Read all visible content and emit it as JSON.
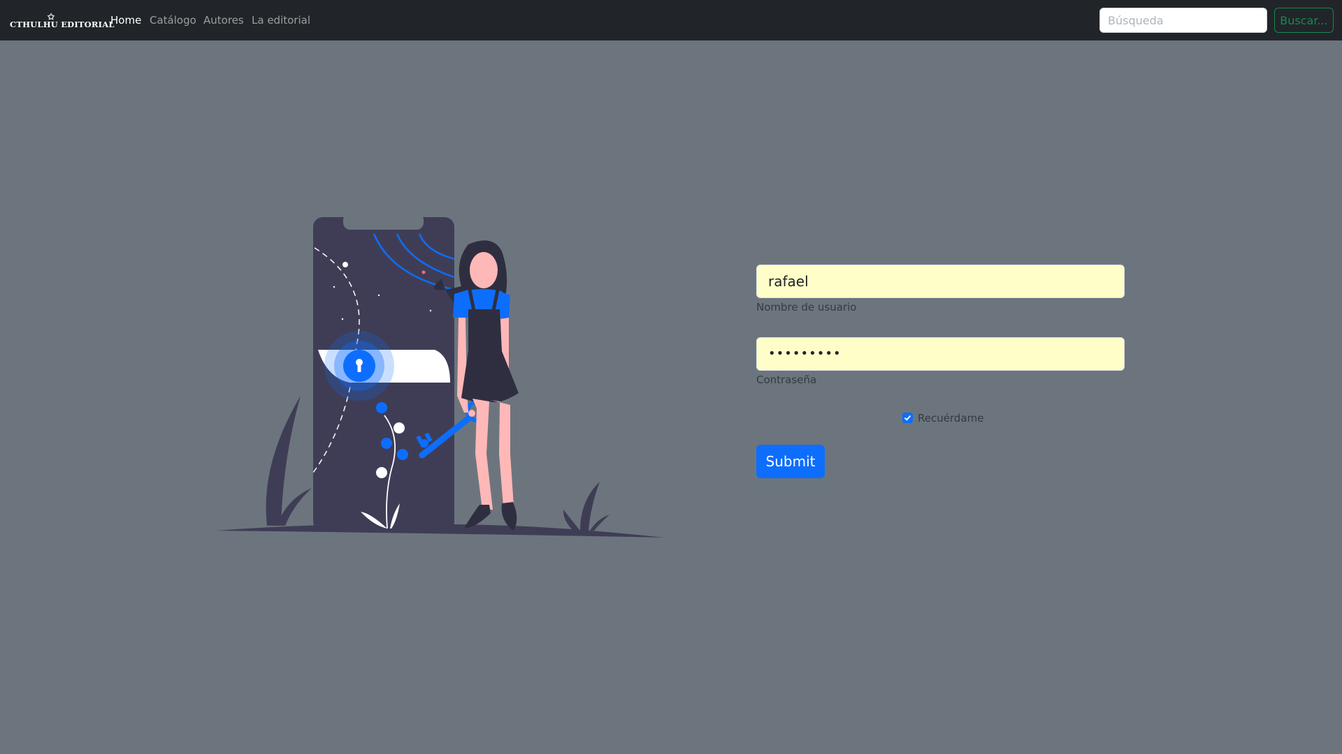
{
  "brand": {
    "name": "CTHULHU EDITORIAL",
    "icon": "star-icon"
  },
  "nav": {
    "items": [
      {
        "label": "Home",
        "active": true
      },
      {
        "label": "Catálogo",
        "active": false
      },
      {
        "label": "Autores",
        "active": false
      },
      {
        "label": "La editorial",
        "active": false
      }
    ]
  },
  "search": {
    "placeholder": "Búsqueda",
    "button_label": "Buscar..."
  },
  "login": {
    "username_value": "rafael",
    "username_help": "Nombre de usuario",
    "password_value": "•••••••••",
    "password_help": "Contraseña",
    "remember_label": "Recuérdame",
    "remember_checked": true,
    "submit_label": "Submit"
  },
  "colors": {
    "navbar": "#212529",
    "page_bg": "#6c757d",
    "primary": "#0d6efd",
    "success": "#198754",
    "autofill_bg": "#fffdc8"
  }
}
